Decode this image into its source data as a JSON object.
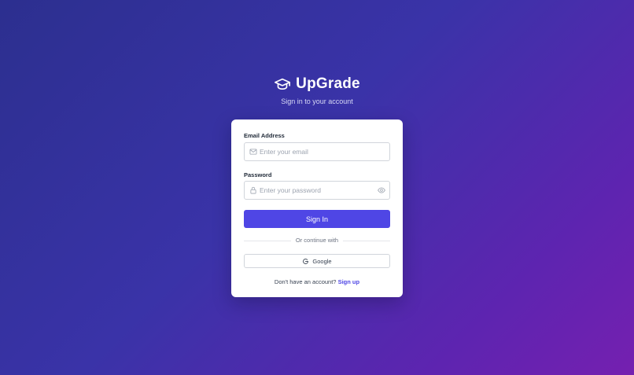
{
  "brand": {
    "name": "UpGrade",
    "subtitle": "Sign in to your account",
    "icon": "graduation-cap-icon"
  },
  "form": {
    "email": {
      "label": "Email Address",
      "placeholder": "Enter your email",
      "value": "",
      "icon": "mail-icon"
    },
    "password": {
      "label": "Password",
      "placeholder": "Enter your password",
      "value": "",
      "icon": "lock-icon",
      "toggle_icon": "eye-icon"
    },
    "submit_label": "Sign In",
    "divider_text": "Or continue with",
    "google_label": "Google",
    "footer_prompt": "Don't have an account?",
    "signup_link": "Sign up"
  },
  "colors": {
    "accent": "#4f46e5",
    "background_start": "#2c2f8f",
    "background_end": "#7520b0",
    "card": "#ffffff"
  }
}
